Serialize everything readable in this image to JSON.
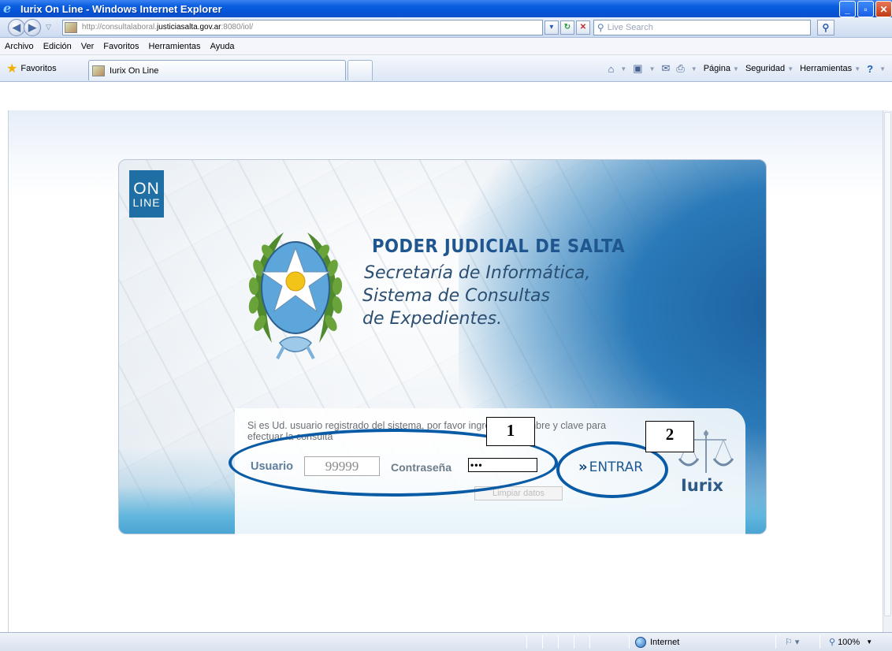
{
  "window": {
    "title": "Iurix On Line - Windows Internet Explorer",
    "buttons": {
      "minimize": "_",
      "maximize": "▫",
      "close": "✕"
    }
  },
  "address": {
    "url_prefix": "http://consultalaboral.",
    "url_domain": "justiciasalta.gov.ar",
    "url_suffix": ":8080/iol/",
    "search_placeholder": "Live Search"
  },
  "menu": {
    "items": [
      "Archivo",
      "Edición",
      "Ver",
      "Favoritos",
      "Herramientas",
      "Ayuda"
    ]
  },
  "favorites": {
    "label": "Favoritos",
    "tab_title": "Iurix On Line",
    "commands": [
      "Página",
      "Seguridad",
      "Herramientas"
    ]
  },
  "page": {
    "badge_top": "ON",
    "badge_bottom": "LINE",
    "org_title": "PODER JUDICIAL DE SALTA",
    "subtitle_lines": [
      "Secretaría de Informática,",
      "Sistema de Consultas",
      "de Expedientes."
    ],
    "login_message": "Si es Ud. usuario registrado del sistema, por favor ingrese su nombre y clave para efectuar la consulta",
    "user_label": "Usuario",
    "user_value": "99999",
    "password_label": "Contraseña",
    "password_value": "•••",
    "enter_label": "ENTRAR",
    "enter_arrows": "»",
    "clear_label": "Limpiar datos",
    "logo_word": "Iurix"
  },
  "annotations": {
    "callout_1": "1",
    "callout_2": "2",
    "color": "#0a5ba5"
  },
  "status": {
    "zone": "Internet",
    "zoom": "100%"
  }
}
